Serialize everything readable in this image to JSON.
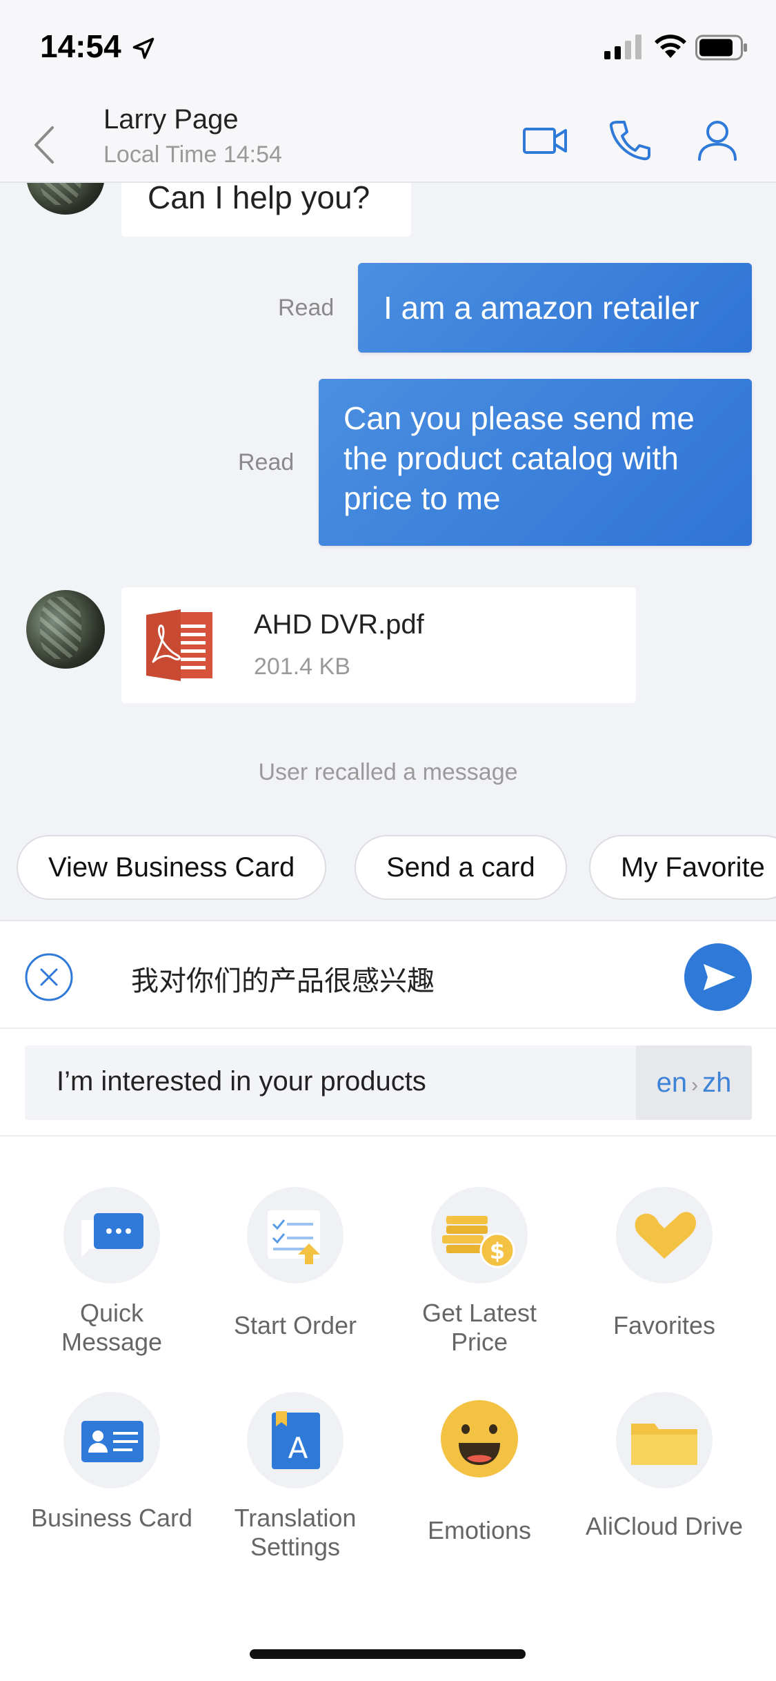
{
  "status_bar": {
    "time": "14:54"
  },
  "header": {
    "contact_name": "Larry Page",
    "local_time": "Local Time 14:54"
  },
  "messages": {
    "incoming_text": "Can I help you?",
    "outgoing_1": {
      "status": "Read",
      "text": "I am a amazon retailer"
    },
    "outgoing_2": {
      "status": "Read",
      "text": "Can you please send me the product catalog with price to me"
    },
    "file": {
      "name": "AHD DVR.pdf",
      "size": "201.4 KB"
    },
    "system_notice": "User recalled a message"
  },
  "quick_chips": [
    "View Business Card",
    "Send a card",
    "My Favorite"
  ],
  "composer": {
    "input_value": "我对你们的产品很感兴趣",
    "translation": "I’m interested in your products",
    "lang_from": "en",
    "lang_to": "zh"
  },
  "tools": [
    {
      "label": "Quick Message",
      "icon": "quick-message-icon"
    },
    {
      "label": "Start Order",
      "icon": "start-order-icon"
    },
    {
      "label": "Get Latest Price",
      "icon": "latest-price-icon"
    },
    {
      "label": "Favorites",
      "icon": "favorites-icon"
    },
    {
      "label": "Business Card",
      "icon": "business-card-icon"
    },
    {
      "label": "Translation Settings",
      "icon": "translation-settings-icon"
    },
    {
      "label": "Emotions",
      "icon": "emotions-icon"
    },
    {
      "label": "AliCloud Drive",
      "icon": "alicloud-drive-icon"
    }
  ],
  "colors": {
    "accent": "#2f7ad9",
    "bubble_out": "#3a82dc",
    "background": "#f2f3f7",
    "pdf_red": "#d6523b",
    "gold": "#f3c242"
  }
}
